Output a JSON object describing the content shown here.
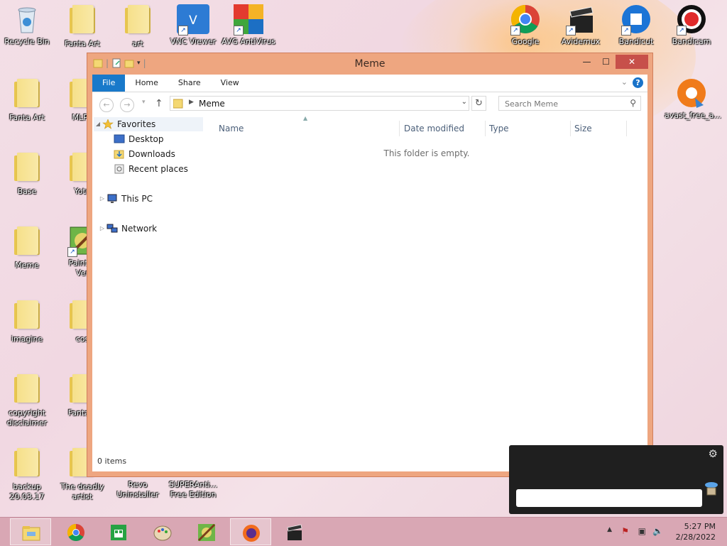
{
  "desktop": {
    "icons": [
      {
        "label": "Recycle Bin"
      },
      {
        "label": "Fanta Art"
      },
      {
        "label": "art"
      },
      {
        "label": "VNC Viewer"
      },
      {
        "label": "AVG AntiVirus"
      },
      {
        "label": "Google"
      },
      {
        "label": "Avidemux"
      },
      {
        "label": "Bandicut"
      },
      {
        "label": "Bandicam"
      },
      {
        "label": "Fanta Art"
      },
      {
        "label": "MLP I"
      },
      {
        "label": "avast_free_a..."
      },
      {
        "label": "Base"
      },
      {
        "label": "Yotu"
      },
      {
        "label": "Meme"
      },
      {
        "label": "PaintTo"
      },
      {
        "label": "imagine"
      },
      {
        "label": "cos"
      },
      {
        "label": "copyright disclaimer"
      },
      {
        "label": "Fanta Y"
      },
      {
        "label": "backup 20.03.17"
      },
      {
        "label": "The deadly artist"
      },
      {
        "label": "Revo Uninstaller"
      },
      {
        "label": "SUPERAnti... Free Edition"
      },
      {
        "label": "Ver"
      }
    ]
  },
  "window": {
    "title": "Meme",
    "minimize": "—",
    "maximize": "☐",
    "close": "✕",
    "ribbon": {
      "tabs": [
        "File",
        "Home",
        "Share",
        "View"
      ],
      "help": "?"
    },
    "address": {
      "crumb": "Meme",
      "search_placeholder": "Search Meme"
    },
    "nav": {
      "favorites": "Favorites",
      "desktop": "Desktop",
      "downloads": "Downloads",
      "recent": "Recent places",
      "this_pc": "This PC",
      "network": "Network"
    },
    "columns": [
      "Name",
      "Date modified",
      "Type",
      "Size"
    ],
    "empty_text": "This folder is empty.",
    "status": "0 items"
  },
  "taskbar": {
    "time": "5:27 PM",
    "date": "2/28/2022"
  },
  "colors": {
    "window_frame": "#eea680",
    "ribbon_file": "#1979ca",
    "close_button": "#c7504a",
    "taskbar": "#d9a7b4"
  }
}
